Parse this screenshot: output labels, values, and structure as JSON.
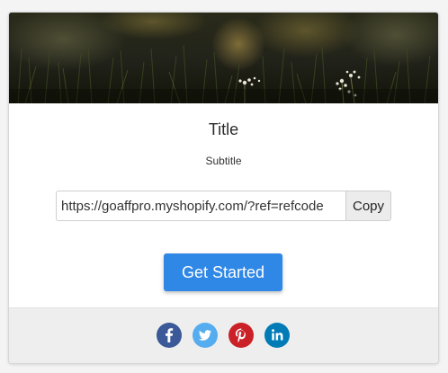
{
  "card": {
    "title": "Title",
    "subtitle": "Subtitle"
  },
  "referral": {
    "link_value": "https://goaffpro.myshopify.com/?ref=refcode",
    "copy_label": "Copy"
  },
  "cta": {
    "label": "Get Started",
    "color": "#2f87e6"
  },
  "social": [
    {
      "network": "facebook",
      "icon": "facebook-icon",
      "color": "#3b5998"
    },
    {
      "network": "twitter",
      "icon": "twitter-icon",
      "color": "#55acee"
    },
    {
      "network": "pinterest",
      "icon": "pinterest-icon",
      "color": "#cb2027"
    },
    {
      "network": "linkedin",
      "icon": "linkedin-icon",
      "color": "#007bb6"
    }
  ]
}
